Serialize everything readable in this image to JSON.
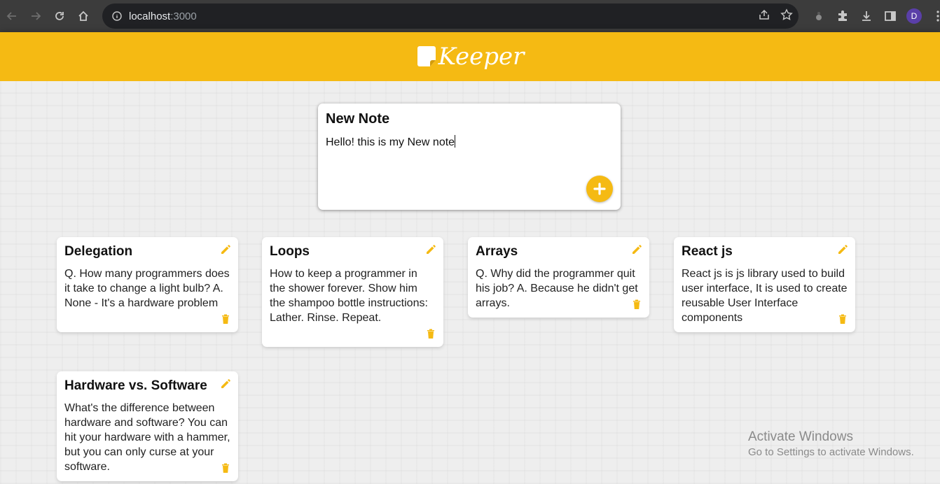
{
  "browser": {
    "url_host": "localhost",
    "url_port": ":3000",
    "profile_initial": "D"
  },
  "app": {
    "logo_text": "Keeper",
    "accent_color": "#f5ba13"
  },
  "create_note": {
    "title": "New Note",
    "content": "Hello! this is my New note"
  },
  "notes": [
    {
      "title": "Delegation",
      "content": "Q. How many programmers does it take to change a light bulb? A. None - It's a hardware problem"
    },
    {
      "title": "Loops",
      "content": "How to keep a programmer in the shower forever. Show him the shampoo bottle instructions: Lather. Rinse. Repeat."
    },
    {
      "title": "Arrays",
      "content": "Q. Why did the programmer quit his job? A. Because he didn't get arrays."
    },
    {
      "title": "React js",
      "content": "React js is js library used to build user interface, It is used to create reusable User Interface components"
    },
    {
      "title": "Hardware vs. Software",
      "content": "What's the difference between hardware and software? You can hit your hardware with a hammer, but you can only curse at your software."
    }
  ],
  "watermark": {
    "line1": "Activate Windows",
    "line2": "Go to Settings to activate Windows."
  }
}
